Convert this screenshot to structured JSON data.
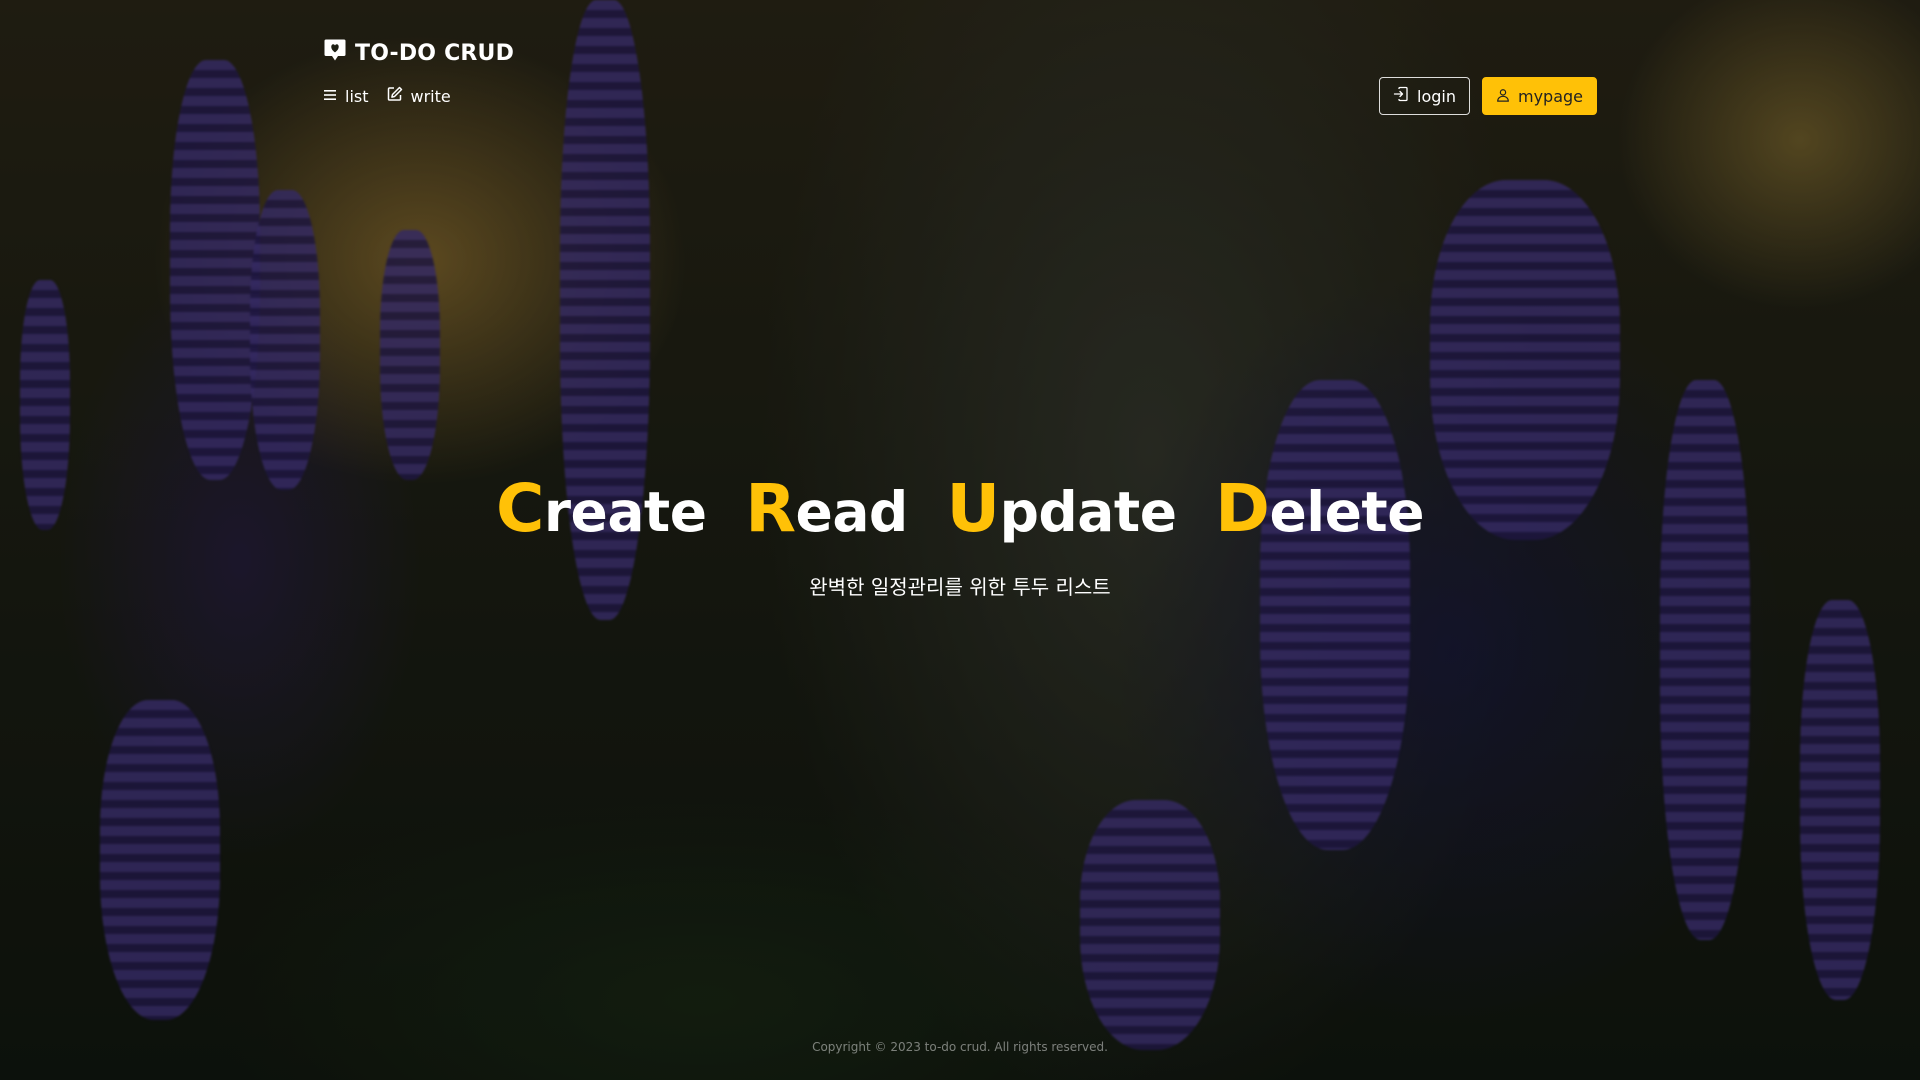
{
  "brand": {
    "name": "TO-DO CRUD",
    "icon": "chat-heart-icon"
  },
  "nav": {
    "items": [
      {
        "label": "list",
        "icon": "list-icon"
      },
      {
        "label": "write",
        "icon": "pencil-square-icon"
      }
    ]
  },
  "auth": {
    "login_label": "login",
    "login_icon": "box-arrow-in-right-icon",
    "mypage_label": "mypage",
    "mypage_icon": "person-icon"
  },
  "hero": {
    "words": [
      {
        "initial": "C",
        "rest": "reate"
      },
      {
        "initial": "R",
        "rest": "ead"
      },
      {
        "initial": "U",
        "rest": "pdate"
      },
      {
        "initial": "D",
        "rest": "elete"
      }
    ],
    "subtitle": "완벽한 일정관리를 위한 투두 리스트"
  },
  "footer": {
    "copyright": "Copyright © 2023 to-do crud. All rights reserved."
  },
  "colors": {
    "accent": "#ffc107",
    "text": "#ffffff",
    "footer_text": "rgba(255,255,255,0.45)"
  }
}
